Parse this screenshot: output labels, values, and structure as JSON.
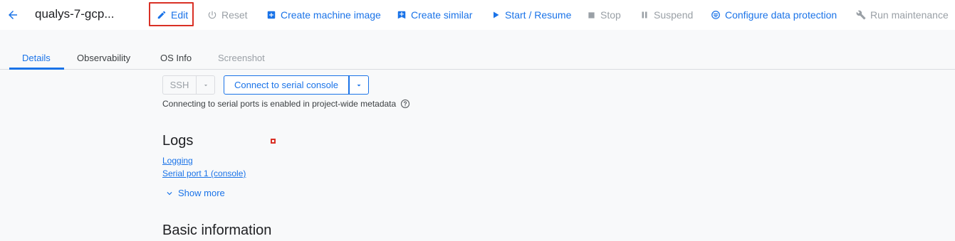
{
  "header": {
    "title": "qualys-7-gcp...",
    "actions": {
      "edit": "Edit",
      "reset": "Reset",
      "create_machine_image": "Create machine image",
      "create_similar": "Create similar",
      "start_resume": "Start / Resume",
      "stop": "Stop",
      "suspend": "Suspend",
      "configure_data_protection": "Configure data protection",
      "run_maintenance": "Run maintenance"
    }
  },
  "tabs": {
    "details": "Details",
    "observability": "Observability",
    "os_info": "OS Info",
    "screenshot": "Screenshot"
  },
  "connect": {
    "ssh_label": "SSH",
    "serial_label": "Connect to serial console",
    "note": "Connecting to serial ports is enabled in project-wide metadata"
  },
  "logs": {
    "heading": "Logs",
    "links": [
      "Logging",
      "Serial port 1 (console)"
    ],
    "show_more": "Show more"
  },
  "basic_information": {
    "heading": "Basic information"
  },
  "colors": {
    "accent": "#1a73e8",
    "disabled": "#9aa0a6",
    "highlight": "#d93025"
  }
}
